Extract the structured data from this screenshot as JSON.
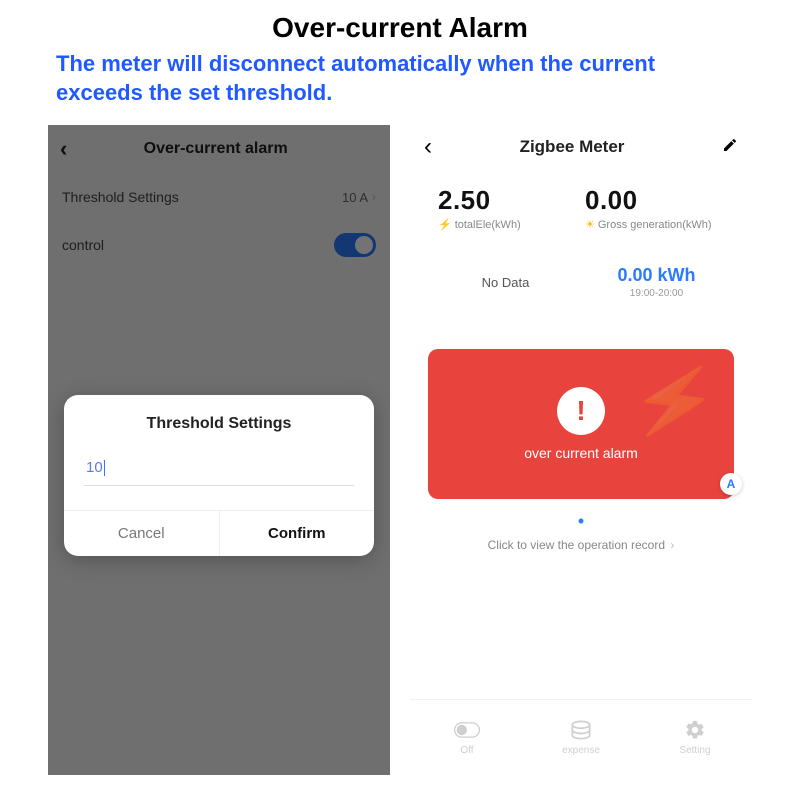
{
  "page": {
    "title": "Over-current Alarm",
    "subtitle": "The meter will disconnect automatically when the current exceeds the set threshold."
  },
  "left": {
    "header": "Over-current alarm",
    "threshold_label": "Threshold Settings",
    "threshold_value": "10 A",
    "control_label": "control",
    "modal": {
      "title": "Threshold Settings",
      "input_value": "10",
      "cancel": "Cancel",
      "confirm": "Confirm"
    }
  },
  "right": {
    "header": "Zigbee Meter",
    "stat1_value": "2.50",
    "stat1_label": "totalEle(kWh)",
    "stat2_value": "0.00",
    "stat2_label": "Gross generation(kWh)",
    "nodata": "No Data",
    "kwh_value": "0.00 kWh",
    "kwh_time": "19:00-20:00",
    "alarm_text": "over current alarm",
    "record_link": "Click to view the operation record",
    "badge": "A",
    "nav": {
      "off": "Off",
      "expense": "expense",
      "setting": "Setting"
    }
  }
}
